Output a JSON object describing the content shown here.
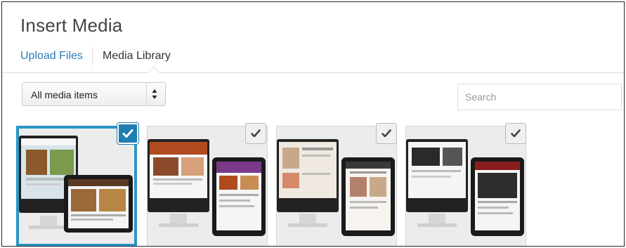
{
  "modal": {
    "title": "Insert Media",
    "tabs": [
      {
        "label": "Upload Files"
      },
      {
        "label": "Media Library"
      }
    ]
  },
  "filter": {
    "selected": "All media items"
  },
  "search": {
    "placeholder": "Search"
  },
  "attachments": [
    {
      "selected": true,
      "theme": "#6b3a1e"
    },
    {
      "selected": false,
      "theme": "#b04a1f"
    },
    {
      "selected": false,
      "theme": "#c7a98a"
    },
    {
      "selected": false,
      "theme": "#2a2a2a"
    }
  ],
  "colors": {
    "link": "#2a7fb3",
    "selection": "#2a95c5",
    "check_active": "#1f7fb2"
  },
  "icons": {
    "check": "check-icon",
    "select_arrows": "updown-arrows-icon"
  }
}
